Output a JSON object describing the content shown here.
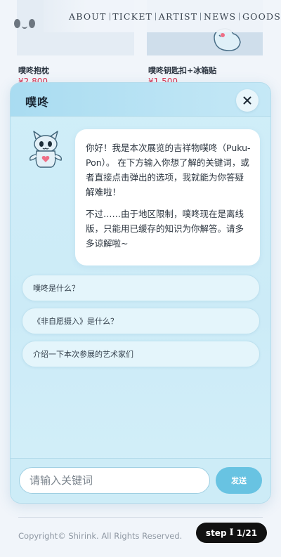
{
  "nav": {
    "items": [
      {
        "label": "ABOUT"
      },
      {
        "label": "TICKET"
      },
      {
        "label": "ARTIST"
      },
      {
        "label": "NEWS"
      },
      {
        "label": "GOODS"
      }
    ]
  },
  "products": [
    {
      "name": "噗咚抱枕",
      "price": "¥2,800"
    },
    {
      "name": "噗咚钥匙扣+冰箱贴",
      "price": "¥1,500"
    }
  ],
  "chat": {
    "title": "噗咚",
    "close_icon": "close-icon",
    "greeting": [
      "你好！我是本次展览的吉祥物噗咚（Puku-Pon）。 在下方输入你想了解的关键词，或者直接点击弹出的选项，我就能为你答疑解难啦！",
      "不过……由于地区限制，噗咚现在是离线版，只能用已缓存的知识为你解答。请多多谅解啦~"
    ],
    "suggestions": [
      {
        "label": "噗咚是什么？"
      },
      {
        "label": "《非自愿摄入》是什么？"
      },
      {
        "label": "介绍一下本次参展的艺术家们"
      }
    ],
    "input": {
      "placeholder": "请输入关键词",
      "value": ""
    },
    "send_label": "发送"
  },
  "footer": {
    "copyright": "Copyright© Shirink. All Rights Reserved."
  },
  "step_indicator": {
    "label": "step",
    "counter": "1/21"
  },
  "colors": {
    "panel": "#ccebf7",
    "header": "#a9dcf1",
    "send_button": "#68c3e2",
    "price": "#d6304e"
  }
}
